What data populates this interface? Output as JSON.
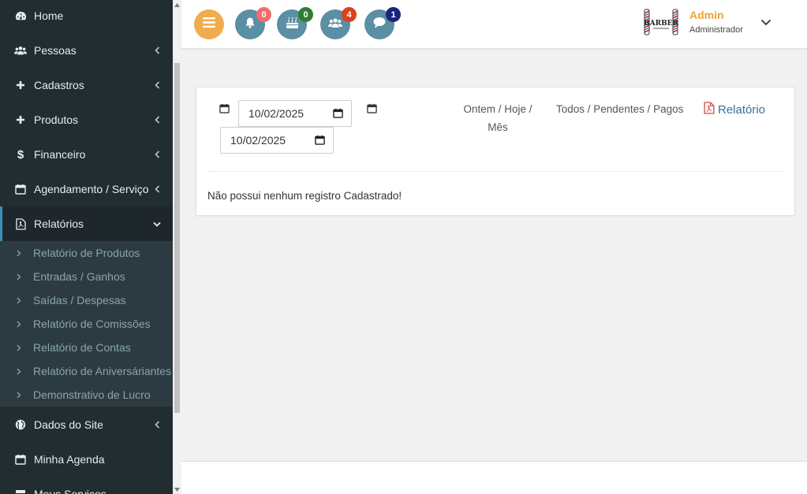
{
  "sidebar": {
    "items": [
      {
        "label": "Home",
        "icon": "dashboard-icon"
      },
      {
        "label": "Pessoas",
        "icon": "users-icon"
      },
      {
        "label": "Cadastros",
        "icon": "plus-icon"
      },
      {
        "label": "Produtos",
        "icon": "plus-icon"
      },
      {
        "label": "Financeiro",
        "icon": "dollar-icon"
      },
      {
        "label": "Agendamento / Serviço",
        "icon": "calendar-icon"
      },
      {
        "label": "Relatórios",
        "icon": "pdf-file-icon"
      },
      {
        "label": "Dados do Site",
        "icon": "globe-icon"
      },
      {
        "label": "Minha Agenda",
        "icon": "calendar-icon"
      },
      {
        "label": "Meus Serviços",
        "icon": "server-icon"
      }
    ],
    "submenu": [
      "Relatório de Produtos",
      "Entradas / Ganhos",
      "Saídas / Despesas",
      "Relatório de Comissões",
      "Relatório de Contas",
      "Relatório de Aniversáriantes",
      "Demonstrativo de Lucro"
    ]
  },
  "topbar": {
    "notifications": [
      {
        "icon": "bell-icon",
        "count": "0",
        "badge_color": "#f26c6c"
      },
      {
        "icon": "birthday-cake-icon",
        "count": "0",
        "badge_color": "#2e7d32"
      },
      {
        "icon": "users-icon",
        "count": "4",
        "badge_color": "#d9431e"
      },
      {
        "icon": "comment-icon",
        "count": "1",
        "badge_color": "#1a237e"
      }
    ],
    "menu_button_color": "#f0ad4e",
    "circle_color": "#5b8fa3"
  },
  "user": {
    "name": "Admin",
    "role": "Administrador",
    "logo_text": "BARBER"
  },
  "filters": {
    "date_start": "10/02/2025",
    "date_end": "10/02/2025",
    "period_line1": "Ontem / Hoje /",
    "period_line2": "Mês",
    "status": "Todos / Pendentes / Pagos",
    "report_label": "Relatório"
  },
  "main": {
    "empty_message": "Não possui nenhum registro Cadastrado!"
  },
  "colors": {
    "sidebar_bg": "#222d32",
    "submenu_bg": "#2c3b41",
    "accent": "#3c8dbc",
    "admin_name": "#e8a33a",
    "pdf_red": "#d9534f"
  }
}
